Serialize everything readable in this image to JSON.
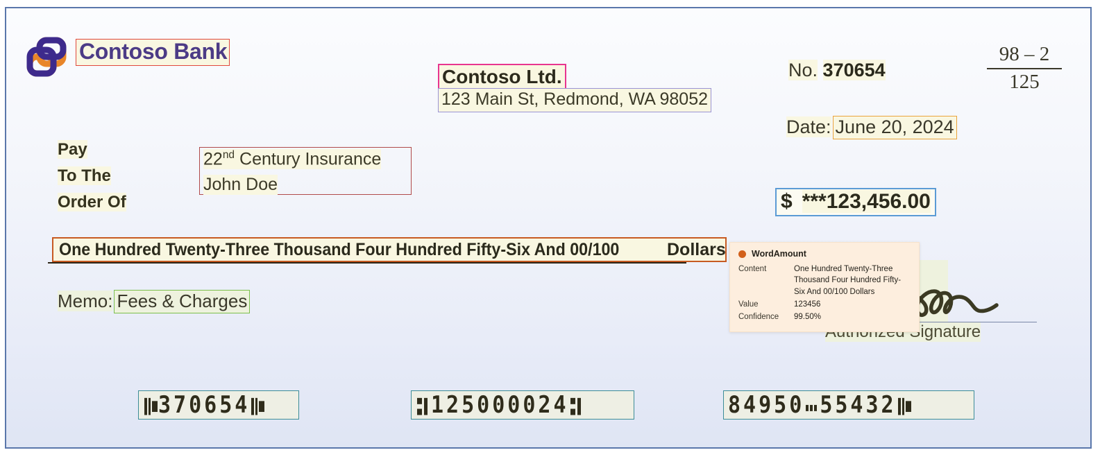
{
  "check": {
    "bank": {
      "name": "Contoso Bank",
      "logo_icon": "contoso-interlocking-rings-logo"
    },
    "payer": {
      "name": "Contoso Ltd.",
      "address": "123 Main St, Redmond, WA 98052"
    },
    "check_number": {
      "label": "No.",
      "value": "370654"
    },
    "routing_fraction": {
      "numerator": "98 – 2",
      "denominator": "125"
    },
    "date": {
      "label": "Date:",
      "value": "June 20, 2024"
    },
    "pay_to": {
      "label_line_1": "Pay",
      "label_line_2": "To The",
      "label_line_3": "Order Of",
      "payee_line_1_number": "22",
      "payee_line_1_ordinal": "nd",
      "payee_line_1_rest": " Century Insurance",
      "payee_line_2": "John Doe"
    },
    "amount": {
      "currency_symbol": "$",
      "value": "***123,456.00"
    },
    "written_amount": {
      "text": "One Hundred Twenty-Three Thousand Four Hundred Fifty-Six And 00/100",
      "dollars_label": "Dollars"
    },
    "memo": {
      "label": "Memo:",
      "value": "Fees & Charges"
    },
    "signature": {
      "label": "Authorized Signature",
      "mark_icon": "handwritten-signature"
    },
    "micr": {
      "check_number": "370654",
      "routing_number": "125000024",
      "account_number_part_1": "84950",
      "account_number_part_2": "55432"
    }
  },
  "tooltip": {
    "field_name": "WordAmount",
    "dot_color": "#d2601a",
    "rows": [
      {
        "key": "Content",
        "value": "One Hundred Twenty-Three Thousand Four Hundred Fifty-Six And 00/100 Dollars"
      },
      {
        "key": "Value",
        "value": "123456"
      },
      {
        "key": "Confidence",
        "value": "99.50%"
      }
    ]
  },
  "ocr_boxes": {
    "bank_name_color": "#e0483c",
    "payer_name_color": "#e8358f",
    "payer_address_color": "#9a93d4",
    "date_color": "#e9a33a",
    "payee_color": "#b04a4a",
    "amount_color": "#5b9bd5",
    "written_amount_color": "#c75a22",
    "memo_color": "#7bbf4a",
    "micr_color": "#3c8c97"
  }
}
